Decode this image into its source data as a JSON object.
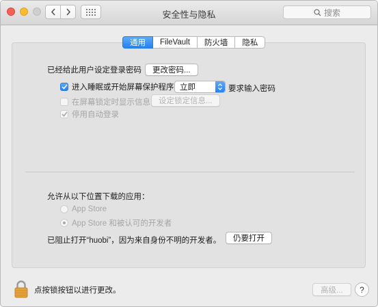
{
  "window": {
    "title": "安全性与隐私"
  },
  "search": {
    "placeholder": "搜索"
  },
  "tabs": [
    {
      "label": "通用",
      "active": true
    },
    {
      "label": "FileVault",
      "active": false
    },
    {
      "label": "防火墙",
      "active": false
    },
    {
      "label": "隐私",
      "active": false
    }
  ],
  "general": {
    "password_set_label": "已经给此用户设定登录密码",
    "change_password_button": "更改密码...",
    "require_password": {
      "label": "进入睡眠或开始屏幕保护程序",
      "checked": true,
      "selected_option": "立即",
      "suffix": "要求输入密码"
    },
    "show_message": {
      "label": "在屏幕锁定时显示信息",
      "checked": false,
      "enabled": false,
      "button": "设定锁定信息..."
    },
    "disable_auto_login": {
      "label": "停用自动登录",
      "checked": true,
      "enabled": false
    }
  },
  "downloads": {
    "heading": "允许从以下位置下载的应用：",
    "options": [
      {
        "label": "App Store",
        "selected": false
      },
      {
        "label": "App Store 和被认可的开发者",
        "selected": true
      }
    ],
    "blocked_message": "已阻止打开“huobi”，因为来自身份不明的开发者。",
    "open_anyway_button": "仍要打开"
  },
  "footer": {
    "lock_message": "点按锁按钮以进行更改。",
    "advanced_button": "高级...",
    "help_label": "?"
  },
  "colors": {
    "accent": "#2183f5",
    "close": "#fd5f57",
    "minimize": "#febd2e",
    "lock": "#e3a33a"
  }
}
